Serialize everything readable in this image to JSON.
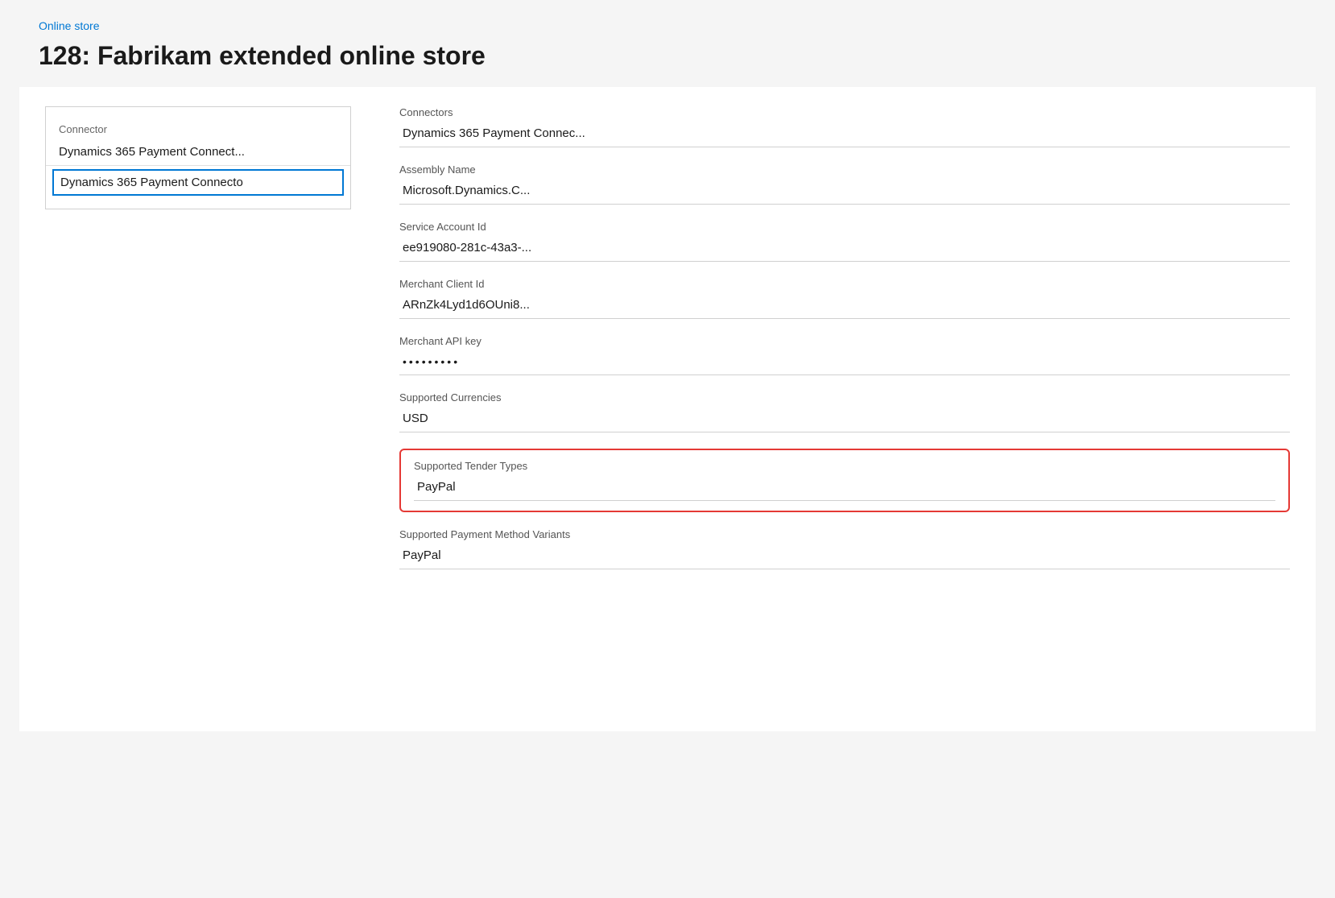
{
  "breadcrumb": {
    "label": "Online store",
    "href": "#"
  },
  "page_title": "128: Fabrikam extended online store",
  "left_panel": {
    "label": "Connector",
    "items": [
      {
        "id": "item1",
        "text": "Dynamics 365 Payment Connect...",
        "selected": false
      },
      {
        "id": "item2",
        "text": "Dynamics 365 Payment Connecto",
        "selected": true
      }
    ]
  },
  "right_panel": {
    "fields": [
      {
        "id": "connectors",
        "label": "Connectors",
        "value": "Dynamics 365 Payment Connec...",
        "highlighted": false,
        "password": false
      },
      {
        "id": "assembly_name",
        "label": "Assembly Name",
        "value": "Microsoft.Dynamics.C...",
        "highlighted": false,
        "password": false
      },
      {
        "id": "service_account_id",
        "label": "Service Account Id",
        "value": "ee919080-281c-43a3-...",
        "highlighted": false,
        "password": false
      },
      {
        "id": "merchant_client_id",
        "label": "Merchant Client Id",
        "value": "ARnZk4Lyd1d6OUni8...",
        "highlighted": false,
        "password": false
      },
      {
        "id": "merchant_api_key",
        "label": "Merchant API key",
        "value": "•••••••••",
        "highlighted": false,
        "password": true
      },
      {
        "id": "supported_currencies",
        "label": "Supported Currencies",
        "value": "USD",
        "highlighted": false,
        "password": false
      },
      {
        "id": "supported_tender_types",
        "label": "Supported Tender Types",
        "value": "PayPal",
        "highlighted": true,
        "password": false
      },
      {
        "id": "supported_payment_method_variants",
        "label": "Supported Payment Method Variants",
        "value": "PayPal",
        "highlighted": false,
        "password": false
      }
    ]
  }
}
